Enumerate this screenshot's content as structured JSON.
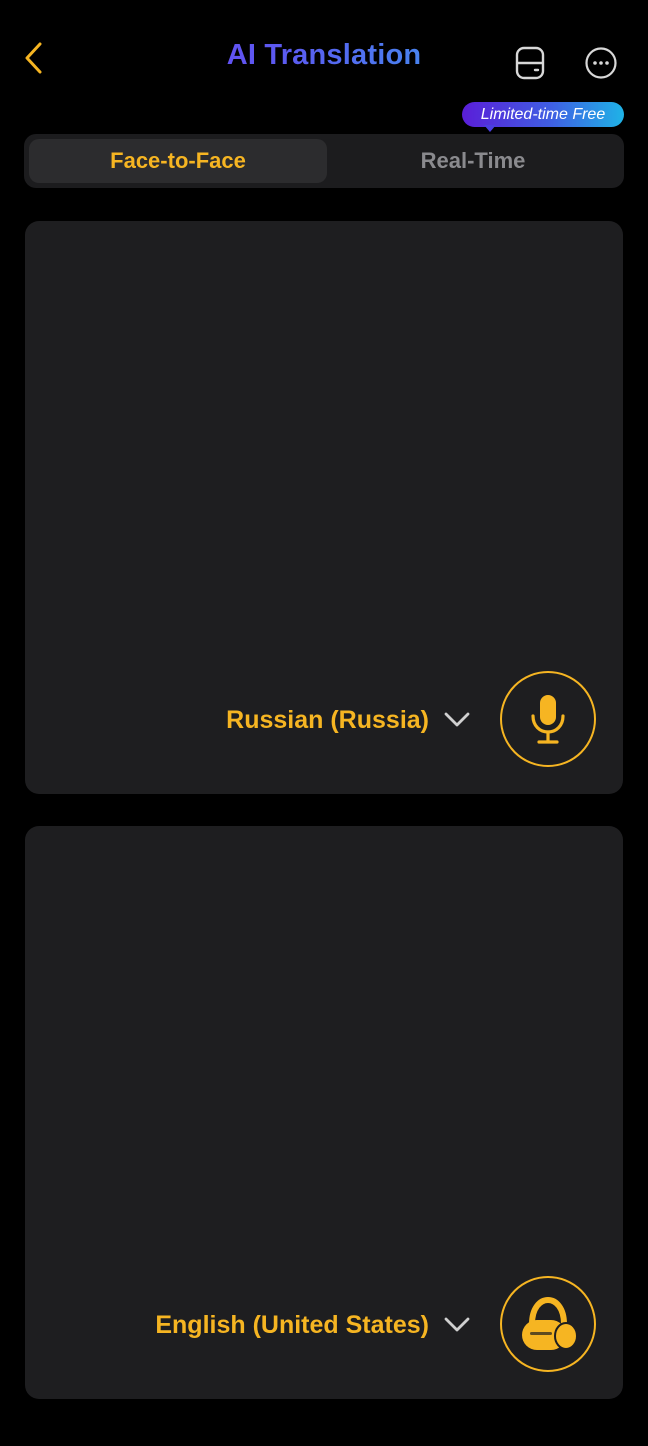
{
  "header": {
    "title": "AI Translation",
    "back_icon": "chevron-left-icon",
    "history_icon": "history-icon",
    "more_icon": "more-icon"
  },
  "badge": {
    "text": "Limited-time Free"
  },
  "tabs": [
    {
      "label": "Face-to-Face",
      "active": true
    },
    {
      "label": "Real-Time",
      "active": false
    }
  ],
  "panels": {
    "top": {
      "language": "Russian (Russia)",
      "button_icon": "microphone-icon"
    },
    "bottom": {
      "language": "English (United States)",
      "button_icon": "earbuds-icon"
    }
  },
  "colors": {
    "accent": "#f6b522",
    "background": "#000000",
    "panel": "#1e1e20",
    "inactive_text": "#8a8a8e",
    "title_gradient_start": "#7b2ff7",
    "title_gradient_end": "#29c6ee"
  }
}
